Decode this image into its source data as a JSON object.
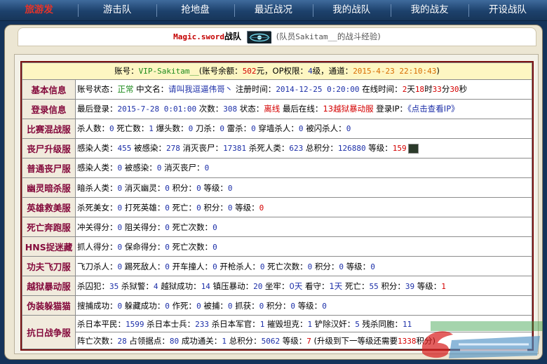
{
  "nav": {
    "items": [
      {
        "label": "旅游发",
        "active": true
      },
      {
        "label": "游击队"
      },
      {
        "label": "抢地盘"
      },
      {
        "label": "最近战况"
      },
      {
        "label": "我的战队"
      },
      {
        "label": "我的战友"
      },
      {
        "label": "开设战队"
      }
    ]
  },
  "header": {
    "team_name": "Magic.sword",
    "team_suffix": "战队",
    "note_prefix": "(队员",
    "member": "Sakitam__",
    "note_suffix": "的战斗经验)"
  },
  "account": {
    "label": "账号：",
    "id": "VIP-Sakitam__",
    "balance_label": "(账号余额：",
    "balance": "502",
    "balance_unit": "元，OP权限：",
    "op": "4",
    "op_unit": "级，通道：",
    "date": "2015-4-23 22:10:43",
    "close": ")"
  },
  "rows": {
    "basic": {
      "category": "基本信息",
      "status_label": "账号状态：",
      "status": "正常",
      "cn_label": "中文名：",
      "cn_name": "请叫我逗逼伟哥丶",
      "reg_label": "注册时间：",
      "reg_time": "2014-12-25 0:20:00",
      "online_label": "在线时间：",
      "days": "2",
      "d_unit": "天",
      "hours": "18",
      "h_unit": "时",
      "mins": "33",
      "m_unit": "分",
      "secs": "30",
      "s_unit": "秒"
    },
    "login": {
      "category": "登录信息",
      "last_label": "最后登录：",
      "last_time": "2015-7-28 0:01:00",
      "count_label": "次数：",
      "count": "308",
      "state_label": "状态：",
      "state": "离线",
      "where_label": "最后在线：",
      "where": "13越狱暴动服",
      "ip_label": "登录IP：",
      "ip": "《点击查看IP》"
    },
    "battle": {
      "category": "比赛混战服",
      "parts": [
        [
          "杀人数：",
          "0"
        ],
        [
          "死亡数：",
          "1"
        ],
        [
          "爆头数：",
          "0"
        ],
        [
          "刀杀：",
          "0"
        ],
        [
          "雷杀：",
          "0"
        ],
        [
          "穿墙杀人：",
          "0"
        ],
        [
          "被闪杀人：",
          "0"
        ]
      ]
    },
    "zombie": {
      "category": "丧尸升级服",
      "parts": [
        [
          "感染人类：",
          "455"
        ],
        [
          "被感染：",
          "278"
        ],
        [
          "消灭丧尸：",
          "17381"
        ],
        [
          "杀死人类：",
          "623"
        ],
        [
          "总积分：",
          "126880"
        ]
      ],
      "level_label": "等级：",
      "level": "159"
    },
    "zombie2": {
      "category": "普通丧尸服",
      "parts": [
        [
          "感染人类：",
          "0"
        ],
        [
          "被感染：",
          "0"
        ],
        [
          "消灭丧尸：",
          "0"
        ]
      ]
    },
    "ghost": {
      "category": "幽灵暗杀服",
      "parts": [
        [
          "暗杀人类：",
          "0"
        ],
        [
          "消灭幽灵：",
          "0"
        ],
        [
          "积分：",
          "0"
        ],
        [
          "等级：",
          "0"
        ]
      ]
    },
    "hero": {
      "category": "英雄救美服",
      "parts": [
        [
          "杀死美女：",
          "0"
        ],
        [
          "打死英雄：",
          "0"
        ],
        [
          "死亡：",
          "0"
        ],
        [
          "积分：",
          "0"
        ]
      ],
      "level_label": "等级：",
      "level": "0"
    },
    "run": {
      "category": "死亡奔跑服",
      "parts": [
        [
          "冲关得分：",
          "0"
        ],
        [
          "阻关得分：",
          "0"
        ],
        [
          "死亡次数：",
          "0"
        ]
      ]
    },
    "hns": {
      "category": "HNS捉迷藏",
      "parts": [
        [
          "抓人得分：",
          "0"
        ],
        [
          "保命得分：",
          "0"
        ],
        [
          "死亡次数：",
          "0"
        ]
      ]
    },
    "kungfu": {
      "category": "功夫飞刀服",
      "parts": [
        [
          "飞刀杀人：",
          "0"
        ],
        [
          "踢死敌人：",
          "0"
        ],
        [
          "开车撞人：",
          "0"
        ],
        [
          "开枪杀人：",
          "0"
        ],
        [
          "死亡次数：",
          "0"
        ],
        [
          "积分：",
          "0"
        ],
        [
          "等级：",
          "0"
        ]
      ]
    },
    "prison": {
      "category": "越狱暴动服",
      "parts": [
        [
          "杀囚犯：",
          "35"
        ],
        [
          "杀狱警：",
          "4"
        ],
        [
          "越狱成功：",
          "14"
        ],
        [
          "镇压暴动：",
          "20"
        ]
      ],
      "jail_label": "坐牢：",
      "jail": "0天",
      "guard_label": "看守：",
      "guard": "1天",
      "parts2": [
        [
          "死亡：",
          "55"
        ],
        [
          "积分：",
          "39"
        ]
      ],
      "level_label": "等级：",
      "level": "1"
    },
    "hide": {
      "category": "伪装躲猫猫",
      "parts": [
        [
          "搜捕成功：",
          "0"
        ],
        [
          "躲藏成功：",
          "0"
        ],
        [
          "作死：",
          "0"
        ],
        [
          "被捕：",
          "0"
        ],
        [
          "抓获：",
          "0"
        ],
        [
          "积分：",
          "0"
        ],
        [
          "等级：",
          "0"
        ]
      ]
    },
    "war": {
      "category": "抗日战争服",
      "parts": [
        [
          "杀日本平民：",
          "1599"
        ],
        [
          "杀日本士兵：",
          "233"
        ],
        [
          "杀日本军官：",
          "1"
        ],
        [
          "摧毁坦克：",
          "1"
        ],
        [
          "铲除汉奸：",
          "5"
        ],
        [
          "残杀同胞：",
          "11"
        ]
      ],
      "parts2": [
        [
          "阵亡次数：",
          "28"
        ],
        [
          "占领据点：",
          "80"
        ],
        [
          "成功通关：",
          "1"
        ],
        [
          "总积分：",
          "5062"
        ]
      ],
      "level_label": "等级：",
      "level": "7",
      "next_prefix": "(升级到下一等级还需要",
      "next": "1338",
      "next_suffix": "积分)"
    }
  },
  "colors": {
    "nav_active": "#e4342a",
    "category": "#840a3c",
    "number": "#1c2fa8",
    "alert": "#d40000"
  }
}
